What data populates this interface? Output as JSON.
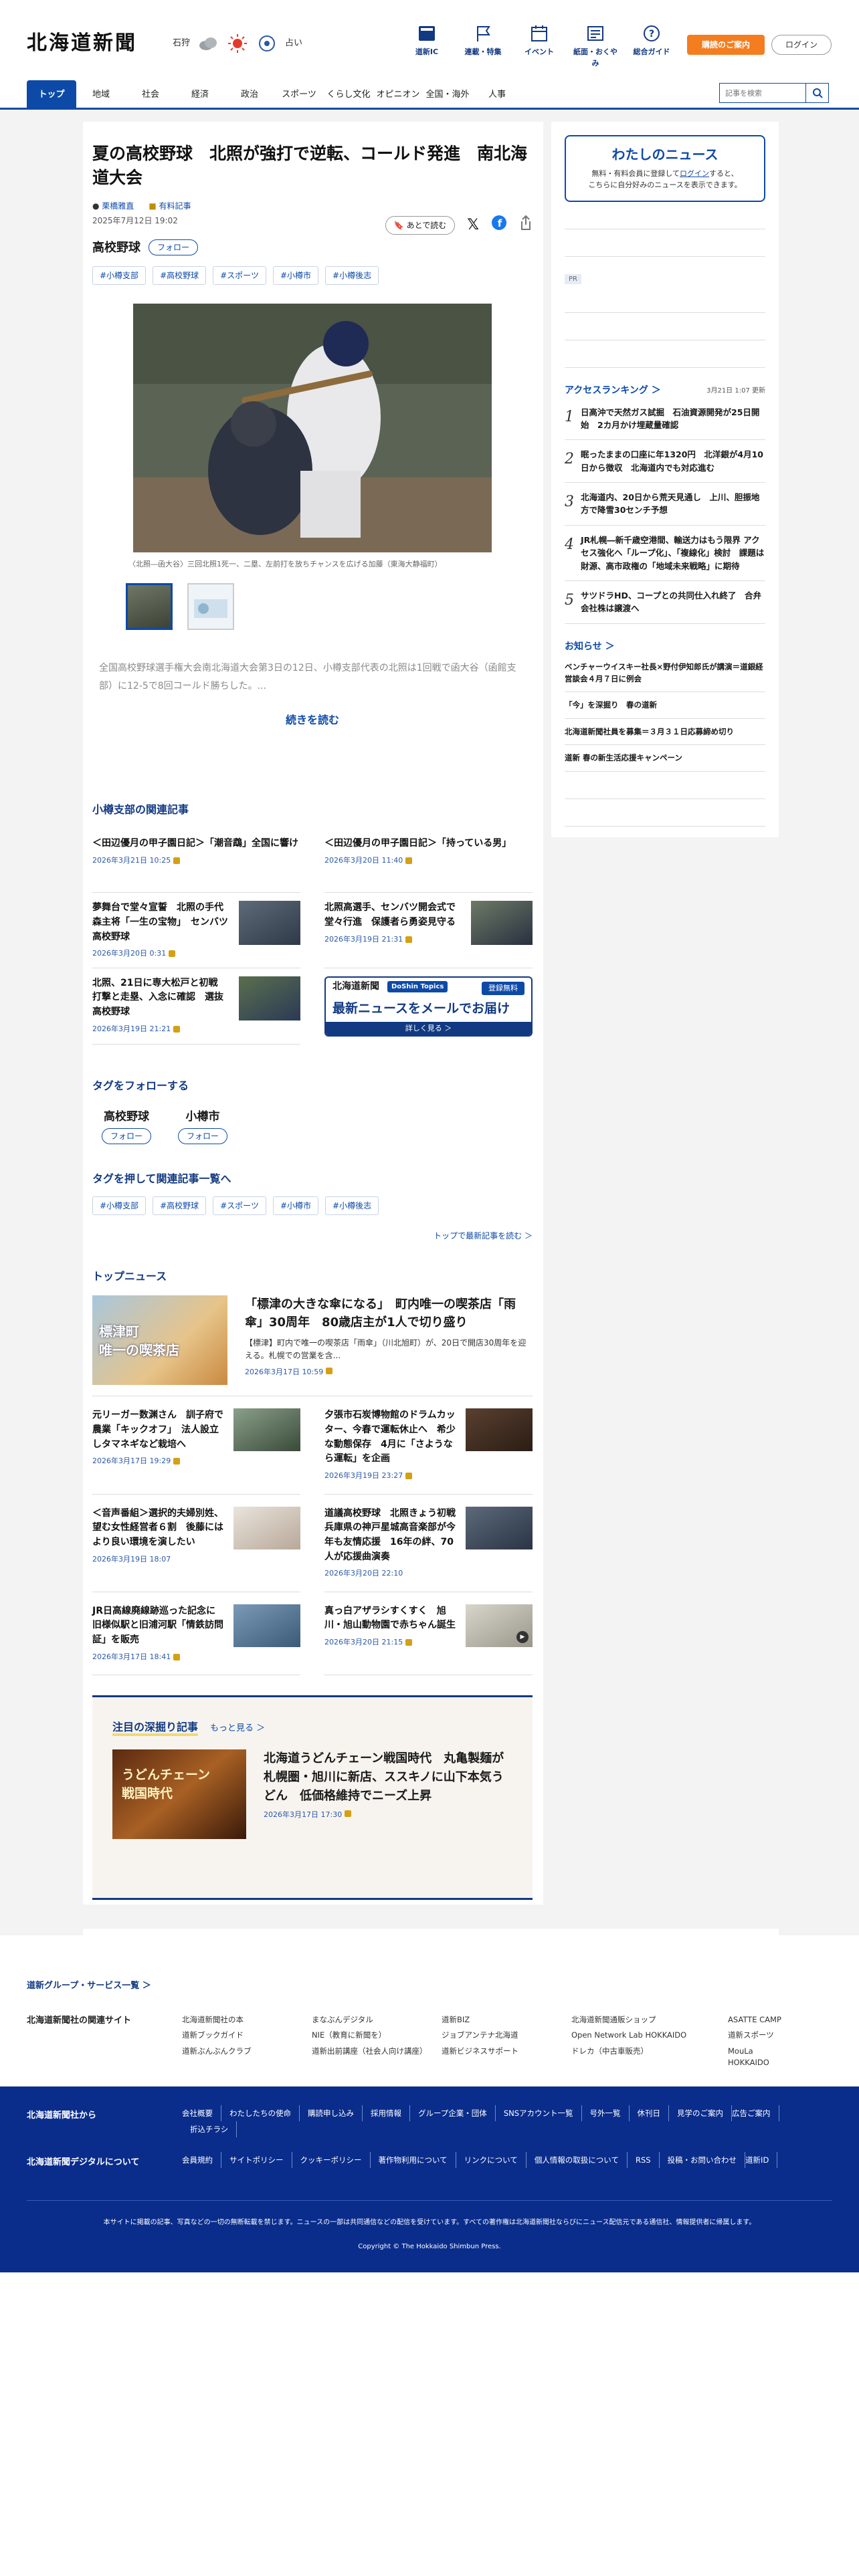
{
  "header": {
    "logo": "北海道新聞",
    "weather_city": "石狩",
    "uv_label": "占い",
    "util": [
      {
        "label": "道新IC",
        "icon": "book-icon"
      },
      {
        "label": "連載・特集",
        "icon": "flag-icon"
      },
      {
        "label": "イベント",
        "icon": "calendar-icon"
      },
      {
        "label": "紙面・おくやみ",
        "icon": "newspaper-icon"
      },
      {
        "label": "総合ガイド",
        "icon": "question-icon"
      }
    ],
    "guide_btn": "購読のご案内",
    "login_btn": "ログイン"
  },
  "nav": {
    "items": [
      "トップ",
      "地域",
      "社会",
      "経済",
      "政治",
      "スポーツ",
      "くらし文化",
      "オピニオン",
      "全国・海外",
      "人事"
    ],
    "search_placeholder": "記事を検索"
  },
  "article": {
    "title": "夏の高校野球　北照が強打で逆転、コールド発進　南北海道大会",
    "author": "栗橋雅直",
    "member": "有料記事",
    "datetime": "2025年7月12日 19:02",
    "save_label": "あとで読む",
    "follow_tag": "高校野球",
    "follow_label": "フォロー",
    "tags": [
      "#小樽支部",
      "#高校野球",
      "#スポーツ",
      "#小樽市",
      "#小樽後志"
    ],
    "caption": "〈北照―函大谷〉三回北照1死一、二塁、左前打を放ちチャンスを広げる加藤（東海大静福町）",
    "lead": "全国高校野球選手権大会南北海道大会第3日の12日、小樽支部代表の北照は1回戦で函大谷（函館支部）に12-5で8回コールド勝ちした。...",
    "read_more": "続きを読む"
  },
  "related": {
    "title": "小樽支部の関連記事",
    "items": [
      {
        "title": "＜田辺優月の甲子園日記＞「潮音鵡」全国に響け",
        "date": "2026年3月21日 10:25",
        "img": false
      },
      {
        "title": "＜田辺優月の甲子園日記＞「持っている男」",
        "date": "2026年3月20日 11:40",
        "img": false
      },
      {
        "title": "夢舞台で堂々宣誓　北照の手代森主将「一生の宝物」　センバツ高校野球",
        "date": "2026年3月20日 0:31",
        "img": true
      },
      {
        "title": "北照高選手、センバツ開会式で堂々行進　保護者ら勇姿見守る",
        "date": "2026年3月19日 21:31",
        "img": true
      },
      {
        "title": "北照、21日に専大松戸と初戦　打撃と走塁、入念に確認　選抜高校野球",
        "date": "2026年3月19日 21:21",
        "img": true
      }
    ],
    "banner": {
      "brand": "北海道新聞",
      "tag": "DoShin Topics",
      "reg": "登録無料",
      "main": "最新ニュースをメールでお届け",
      "sub": "詳しく見る ＞"
    }
  },
  "follow_tags": {
    "title": "タグをフォローする",
    "items": [
      "高校野球",
      "小樽市"
    ],
    "follow_label": "フォロー"
  },
  "tag_list": {
    "title": "タグを押して関連記事一覧へ",
    "tags": [
      "#小樽支部",
      "#高校野球",
      "#スポーツ",
      "#小樽市",
      "#小樽後志"
    ],
    "more": "トップで最新記事を読む ＞"
  },
  "top_news": {
    "title": "トップニュース",
    "big": {
      "title": "「標津の大きな傘になる」　町内唯一の喫茶店「雨傘」30周年　80歳店主が1人で切り盛り",
      "desc": "【標津】町内で唯一の喫茶店「雨傘」（川北旭町）が、20日で開店30周年を迎える。札幌での営業を含...",
      "date": "2026年3月17日 10:59",
      "img_text": "標津町\n唯一の喫茶店"
    },
    "items": [
      {
        "title": "元リーガー数渊さん　訓子府で農業「キックオフ」　法人設立しタマネギなど栽培へ",
        "date": "2026年3月17日 19:29"
      },
      {
        "title": "夕張市石炭博物館のドラムカッター、今春で運転休止へ　希少な動態保存　4月に「さようなら運転」を企画",
        "date": "2026年3月19日 23:27"
      },
      {
        "title": "＜音声番組＞選択的夫婦別姓、望む女性経営者６割　後藤にはより良い環境を演したい",
        "date": "2026年3月19日 18:07"
      },
      {
        "title": "道議高校野球　北照きょう初戦　兵庫県の神戸星城高音楽部が今年も友情応援　16年の絆、70人が応援曲演奏",
        "date": "2026年3月20日 22:10"
      },
      {
        "title": "JR日高線廃線跡巡った記念に　旧様似駅と旧浦河駅「情鉄訪問証」を販売",
        "date": "2026年3月17日 18:41"
      },
      {
        "title": "真っ白アザラシすくすく　旭川・旭山動物園で赤ちゃん誕生",
        "date": "2026年3月20日 21:15"
      }
    ]
  },
  "deep": {
    "title": "注目の深掘り記事",
    "more": "もっと見る ＞",
    "article": {
      "title": "北海道うどんチェーン戦国時代　丸亀製麺が札幌圏・旭川に新店、ススキノに山下本気うどん　低価格維持でニーズ上昇",
      "date": "2026年3月17日 17:30",
      "img_text": "うどんチェーン\n戦国時代"
    }
  },
  "sidebar": {
    "my_news": {
      "title": "わたしのニュース",
      "line1": "無料・有料会員に登録して",
      "login": "ログイン",
      "line1b": "すると、",
      "line2": "こちらに自分好みのニュースを表示できます。"
    },
    "pr": "PR",
    "ranking": {
      "title": "アクセスランキング ＞",
      "updated": "3月21日 1:07 更新",
      "items": [
        "日高沖で天然ガス試掘　石油資源開発が25日開始　2カ月かけ埋蔵量確認",
        "眠ったままの口座に年1320円　北洋銀が4月10日から徴収　北海道内でも対応進む",
        "北海道内、20日から荒天見通し　上川、胆振地方で降雪30センチ予想",
        "JR札幌―新千歳空港間、輸送力はもう限界 アクセス強化へ「ループ化」、「複線化」検討　課題は財源、高市政権の「地域未来戦略」に期待",
        "サツドラHD、コープとの共同仕入れ終了　合弁会社株は譲渡へ"
      ]
    },
    "notice": {
      "title": "お知らせ ＞",
      "items": [
        "ベンチャーウイスキー社長×野付伊知郎氏が講演＝道銀経営談会４月７日に例会",
        "「今」を深掘り　春の道新",
        "北海道新聞社員を募集＝３月３１日応募締め切り",
        "道新 春の新生活応援キャンペーン"
      ]
    }
  },
  "footer": {
    "group_link": "道新グループ・サービス一覧 ＞",
    "related_label": "北海道新聞社の関連サイト",
    "sites": [
      "北海道新聞社の本",
      "まなぶんデジタル",
      "道新BIZ",
      "北海道新聞通販ショップ",
      "ASATTE CAMP",
      "道新ブックガイド",
      "NIE（教育に新聞を）",
      "ジョブアンテナ北海道",
      "Open Network Lab HOKKAIDO",
      "道新スポーツ",
      "道新ぶんぶんクラブ",
      "道新出前講座（社会人向け講座）",
      "道新ビジネスサポート",
      "ドレカ（中古車販売）",
      "MouLa HOKKAIDO"
    ],
    "from_label": "北海道新聞社から",
    "from_links": [
      "会社概要",
      "わたしたちの使命",
      "購読申し込み",
      "採用情報",
      "グループ企業・団体",
      "SNSアカウント一覧",
      "号外一覧",
      "休刊日",
      "見学のご案内",
      "広告ご案内",
      "折込チラシ"
    ],
    "digital_label": "北海道新聞デジタルについて",
    "digital_links": [
      "会員規約",
      "サイトポリシー",
      "クッキーポリシー",
      "著作物利用について",
      "リンクについて",
      "個人情報の取扱について",
      "RSS",
      "投稿・お問い合わせ",
      "道新ID"
    ],
    "note": "本サイトに掲載の記事、写真などの一切の無断転載を禁じます。ニュースの一部は共同通信などの配信を受けています。すべての著作権は北海道新聞社ならびにニュース配信元である通信社、情報提供者に帰属します。",
    "copyright": "Copyright © The Hokkaido Shimbun Press."
  },
  "colors": {
    "brand_blue": "#0d4aa8",
    "navy": "#0a2d8c",
    "orange": "#f47d20",
    "lock_gold": "#d4a015"
  }
}
